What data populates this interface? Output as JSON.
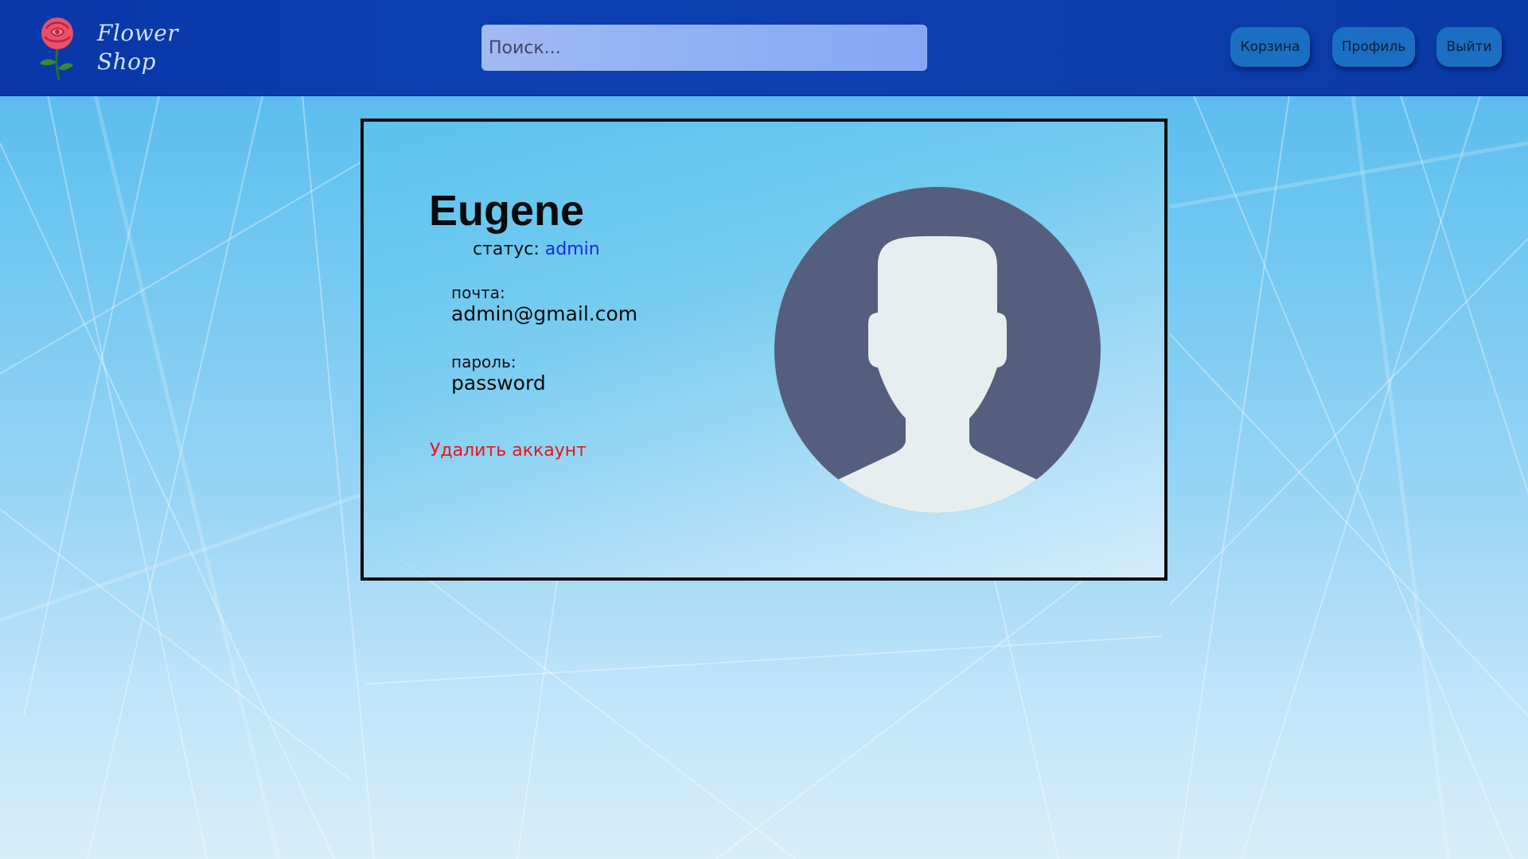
{
  "header": {
    "logo_line1": "Flower",
    "logo_line2": "Shop",
    "search_placeholder": "Поиск...",
    "nav": {
      "cart": "Корзина",
      "profile": "Профиль",
      "logout": "Выйти"
    }
  },
  "profile": {
    "name": "Eugene",
    "status_label": "статус:",
    "status_value": "admin",
    "email_label": "почта:",
    "email_value": "admin@gmail.com",
    "password_label": "пароль:",
    "password_value": "password",
    "delete_account": "Удалить аккаунт"
  },
  "colors": {
    "header_bg": "#0b3fb0",
    "button_bg": "#1a6fc2",
    "status_value": "#1a2bd6",
    "delete_link": "#e8141c",
    "avatar_bg": "#555f7d",
    "avatar_figure": "#e7eeef"
  },
  "icons": {
    "logo": "rose-icon",
    "avatar": "user-avatar-icon"
  }
}
